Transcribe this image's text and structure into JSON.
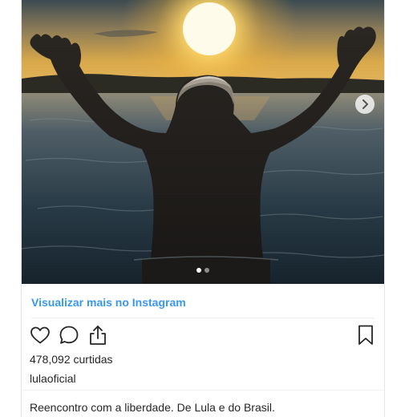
{
  "post": {
    "view_more_label": "Visualizar mais no Instagram",
    "likes_text": "478,092 curtidas",
    "username": "lulaoficial",
    "caption": "Reencontro com a liberdade. De Lula e do Brasil."
  },
  "carousel": {
    "total_slides": 2,
    "current_slide": 1
  },
  "icons": {
    "like": "heart-outline",
    "comment": "speech-bubble",
    "share": "share-arrow",
    "save": "bookmark-outline",
    "next": "chevron-right"
  },
  "colors": {
    "link": "#3897f0",
    "text": "#262626",
    "border": "#e6e6e6"
  }
}
